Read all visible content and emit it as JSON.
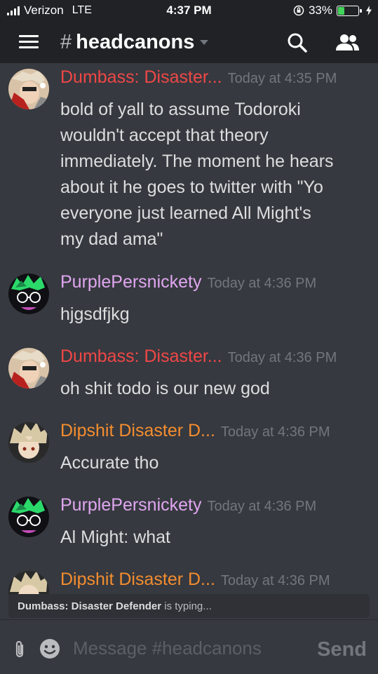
{
  "status": {
    "carrier": "Verizon",
    "network": "LTE",
    "time": "4:37 PM",
    "battery": "33%",
    "battery_level": 0.33,
    "battery_color": "#43d45b"
  },
  "header": {
    "hash": "#",
    "channel": "headcanons"
  },
  "colors": {
    "dumbass": "#f04747",
    "purple": "#e0a6f0",
    "dipshit": "#f48d2f"
  },
  "messages": [
    {
      "author": "Dumbass: Disaster...",
      "timestamp": "Today at 4:35 PM",
      "lines": [
        "bold of yall to assume Todoroki",
        "wouldn't accept that theory",
        "immediately. The moment he hears",
        "about it he goes to twitter with \"Yo",
        "everyone just learned All Might's",
        "my dad ama\""
      ]
    },
    {
      "author": "PurplePersnickety",
      "timestamp": "Today at 4:36 PM",
      "lines": [
        "hjgsdfjkg"
      ]
    },
    {
      "author": "Dumbass: Disaster...",
      "timestamp": "Today at 4:36 PM",
      "lines": [
        "oh shit todo is our new god"
      ]
    },
    {
      "author": "Dipshit Disaster D...",
      "timestamp": "Today at 4:36 PM",
      "lines": [
        "Accurate tho"
      ]
    },
    {
      "author": "PurplePersnickety",
      "timestamp": "Today at 4:36 PM",
      "lines": [
        "Al Might: what"
      ]
    },
    {
      "author": "Dipshit Disaster D...",
      "timestamp": "Today at 4:36 PM",
      "lines": []
    }
  ],
  "typing": {
    "user": "Dumbass: Disaster Defender",
    "text": " is typing..."
  },
  "composer": {
    "placeholder": "Message #headcanons",
    "send_label": "Send"
  }
}
